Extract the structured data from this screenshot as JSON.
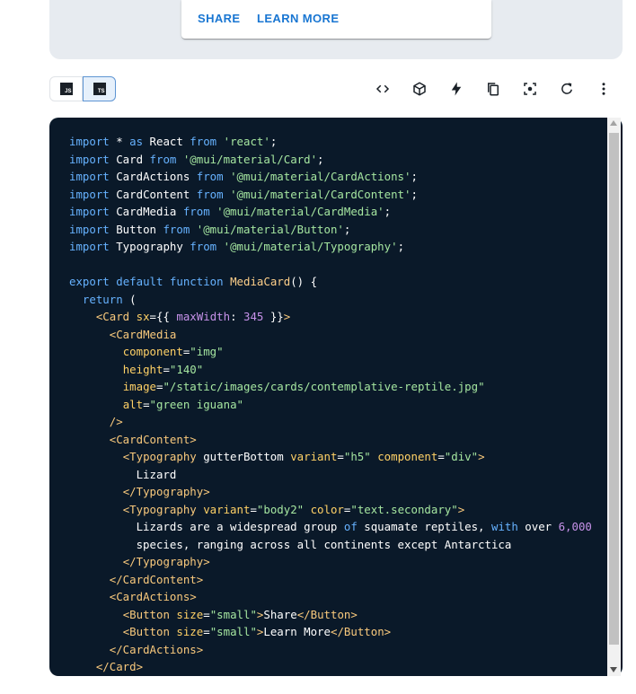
{
  "card": {
    "share_label": "SHARE",
    "learn_more_label": "LEARN MORE"
  },
  "toolbar": {
    "js_label": "JS",
    "ts_label": "TS",
    "icons": [
      "code-icon",
      "codesandbox-icon",
      "stackblitz-icon",
      "copy-icon",
      "focus-icon",
      "reset-icon",
      "more-icon"
    ]
  },
  "code": {
    "lines": [
      "import * as React from 'react';",
      "import Card from '@mui/material/Card';",
      "import CardActions from '@mui/material/CardActions';",
      "import CardContent from '@mui/material/CardContent';",
      "import CardMedia from '@mui/material/CardMedia';",
      "import Button from '@mui/material/Button';",
      "import Typography from '@mui/material/Typography';",
      "",
      "export default function MediaCard() {",
      "  return (",
      "    <Card sx={{ maxWidth: 345 }}>",
      "      <CardMedia",
      "        component=\"img\"",
      "        height=\"140\"",
      "        image=\"/static/images/cards/contemplative-reptile.jpg\"",
      "        alt=\"green iguana\"",
      "      />",
      "      <CardContent>",
      "        <Typography gutterBottom variant=\"h5\" component=\"div\">",
      "          Lizard",
      "        </Typography>",
      "        <Typography variant=\"body2\" color=\"text.secondary\">",
      "          Lizards are a widespread group of squamate reptiles, with over 6,000",
      "          species, ranging across all continents except Antarctica",
      "        </Typography>",
      "      </CardContent>",
      "      <CardActions>",
      "        <Button size=\"small\">Share</Button>",
      "        <Button size=\"small\">Learn More</Button>",
      "      </CardActions>",
      "    </Card>"
    ]
  },
  "colors": {
    "accent": "#1976d2",
    "code_bg": "#0a1929",
    "demo_bg": "#e7ebf0"
  }
}
